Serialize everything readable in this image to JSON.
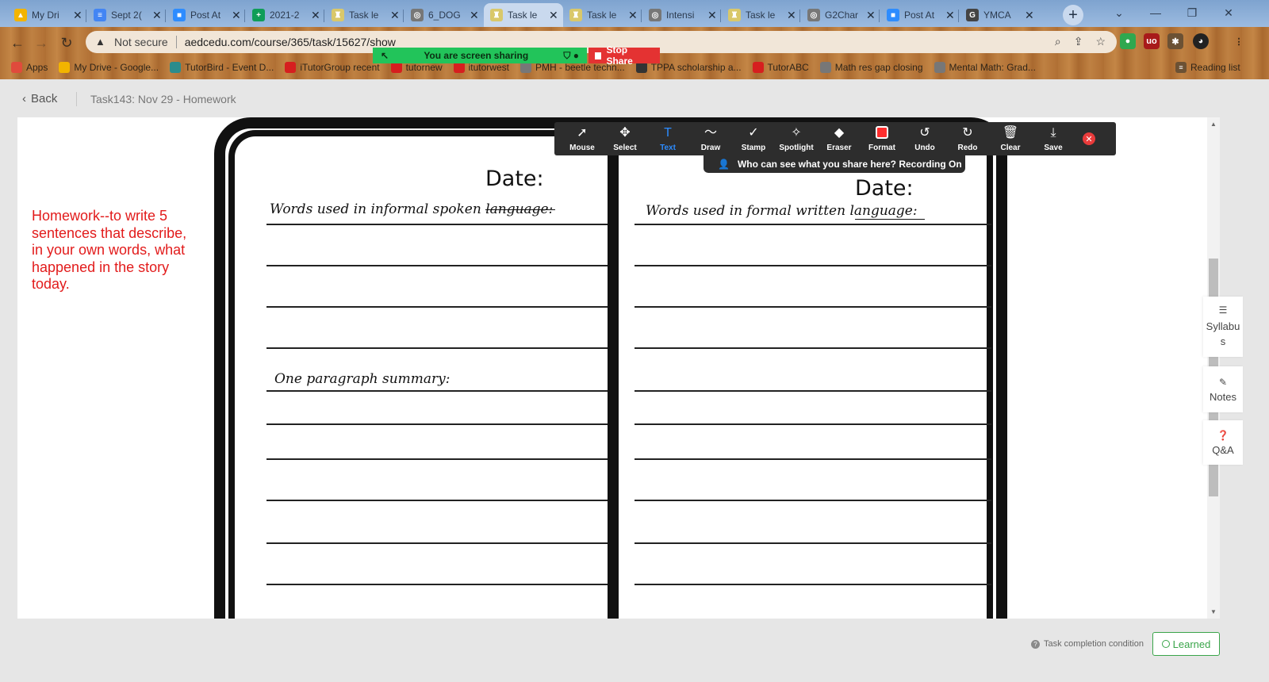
{
  "browser": {
    "tabs": [
      {
        "label": "My Dri",
        "color": "#f2b400",
        "glyph": "▲"
      },
      {
        "label": "Sept 2(",
        "color": "#4285f4",
        "glyph": "≡"
      },
      {
        "label": "Post At",
        "color": "#2d8cff",
        "glyph": "■"
      },
      {
        "label": "2021-2",
        "color": "#0f9d58",
        "glyph": "+"
      },
      {
        "label": "Task le",
        "color": "#d9c86a",
        "glyph": "♜"
      },
      {
        "label": "6_DOG",
        "color": "#777777",
        "glyph": "◎"
      },
      {
        "label": "Task le",
        "color": "#d9c86a",
        "glyph": "♜"
      },
      {
        "label": "Task le",
        "color": "#d9c86a",
        "glyph": "♜"
      },
      {
        "label": "Intensi",
        "color": "#777777",
        "glyph": "◎"
      },
      {
        "label": "Task le",
        "color": "#d9c86a",
        "glyph": "♜"
      },
      {
        "label": "G2Char",
        "color": "#777777",
        "glyph": "◎"
      },
      {
        "label": "Post At",
        "color": "#2d8cff",
        "glyph": "■"
      },
      {
        "label": "YMCA",
        "color": "#444444",
        "glyph": "G"
      }
    ],
    "security_label": "Not secure",
    "url": "aedcedu.com/course/365/task/15627/show",
    "bookmarks": [
      {
        "label": "Apps",
        "color": "#e04b3c"
      },
      {
        "label": "My Drive - Google...",
        "color": "#f2b400"
      },
      {
        "label": "TutorBird - Event D...",
        "color": "#2b8c8c"
      },
      {
        "label": "iTutorGroup recent",
        "color": "#d61f1f"
      },
      {
        "label": "tutornew",
        "color": "#d61f1f"
      },
      {
        "label": "itutorwest",
        "color": "#d61f1f"
      },
      {
        "label": "PMH - beetle techn...",
        "color": "#777777"
      },
      {
        "label": "TPPA scholarship a...",
        "color": "#333333"
      },
      {
        "label": "TutorABC",
        "color": "#d61f1f"
      },
      {
        "label": "Math res gap closing",
        "color": "#777777"
      },
      {
        "label": "Mental Math: Grad...",
        "color": "#777777"
      }
    ],
    "reading_list": "Reading list"
  },
  "zoom": {
    "sharing_label": "You are screen sharing",
    "stop_label": "Stop Share",
    "tools": [
      {
        "label": "Mouse",
        "icon": "➚"
      },
      {
        "label": "Select",
        "icon": "✥"
      },
      {
        "label": "Text",
        "icon": "T"
      },
      {
        "label": "Draw",
        "icon": "〜"
      },
      {
        "label": "Stamp",
        "icon": "✓"
      },
      {
        "label": "Spotlight",
        "icon": "✧"
      },
      {
        "label": "Eraser",
        "icon": "◆"
      },
      {
        "label": "Format",
        "icon": ""
      },
      {
        "label": "Undo",
        "icon": "↺"
      },
      {
        "label": "Redo",
        "icon": "↻"
      },
      {
        "label": "Clear",
        "icon": "🗑"
      },
      {
        "label": "Save",
        "icon": "⤓"
      }
    ],
    "recording_banner": "Who can see what you share here? Recording On"
  },
  "page": {
    "back_label": "Back",
    "breadcrumb": "Task143:  Nov 29 - Homework",
    "homework_note": "Homework--to write 5 sentences that describe, in your own words, what happened in the story today.",
    "worksheet": {
      "date_label": "Date:",
      "left_heading": "Words used in informal spoken language:",
      "right_heading": "Words used in formal written language:",
      "summary_heading": "One paragraph summary:"
    },
    "side_tabs": {
      "syllabus": "Syllabus",
      "notes": "Notes",
      "qa": "Q&A"
    },
    "completion_condition": "Task completion condition",
    "learned_label": "Learned"
  }
}
